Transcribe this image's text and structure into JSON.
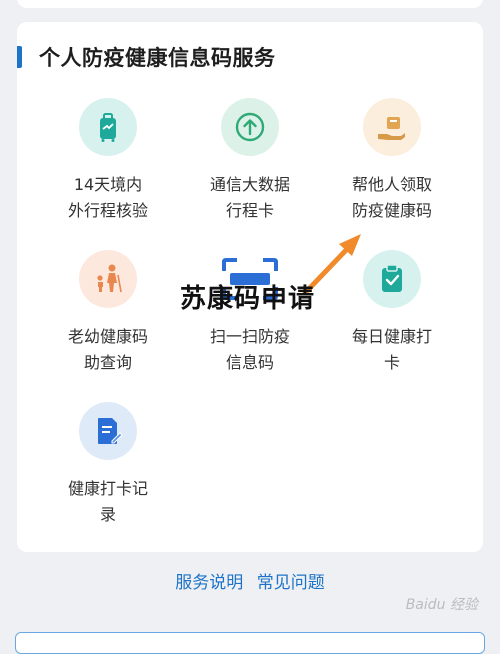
{
  "section": {
    "title": "个人防疫健康信息码服务"
  },
  "services": [
    {
      "line1": "14天境内",
      "line2": "外行程核验"
    },
    {
      "line1": "通信大数据",
      "line2": "行程卡"
    },
    {
      "line1": "帮他人领取",
      "line2": "防疫健康码"
    },
    {
      "line1": "老幼健康码",
      "line2": "助查询"
    },
    {
      "line1": "扫一扫防疫",
      "line2": "信息码"
    },
    {
      "line1": "每日健康打",
      "line2": "卡"
    },
    {
      "line1": "健康打卡记",
      "line2": "录"
    }
  ],
  "overlay": {
    "text": "苏康码申请"
  },
  "footer": {
    "link1": "服务说明",
    "link2": "常见问题"
  },
  "watermark": {
    "text": "Baidu 经验"
  },
  "colors": {
    "accent": "#1e73c8",
    "arrow": "#f08a2b"
  }
}
